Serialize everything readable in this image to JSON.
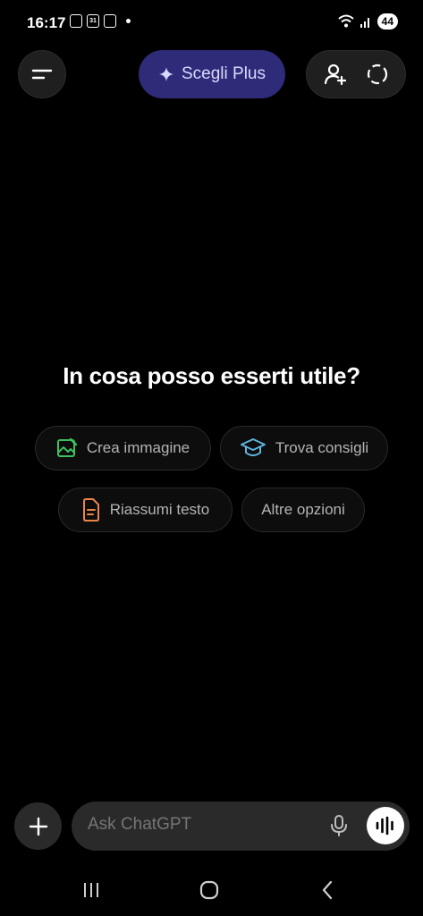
{
  "status_bar": {
    "time": "16:17",
    "calendar_day": "31",
    "battery": "44"
  },
  "header": {
    "plus_label": "Scegli Plus",
    "accent_color": "#2e2b78"
  },
  "main": {
    "headline": "In cosa posso esserti utile?",
    "chips": [
      {
        "label": "Crea immagine",
        "icon": "image-edit-icon",
        "color": "#3fbf5f"
      },
      {
        "label": "Trova consigli",
        "icon": "graduation-cap-icon",
        "color": "#5fb4e0"
      },
      {
        "label": "Riassumi testo",
        "icon": "document-icon",
        "color": "#e8854a"
      },
      {
        "label": "Altre opzioni"
      }
    ]
  },
  "composer": {
    "placeholder": "Ask ChatGPT"
  }
}
